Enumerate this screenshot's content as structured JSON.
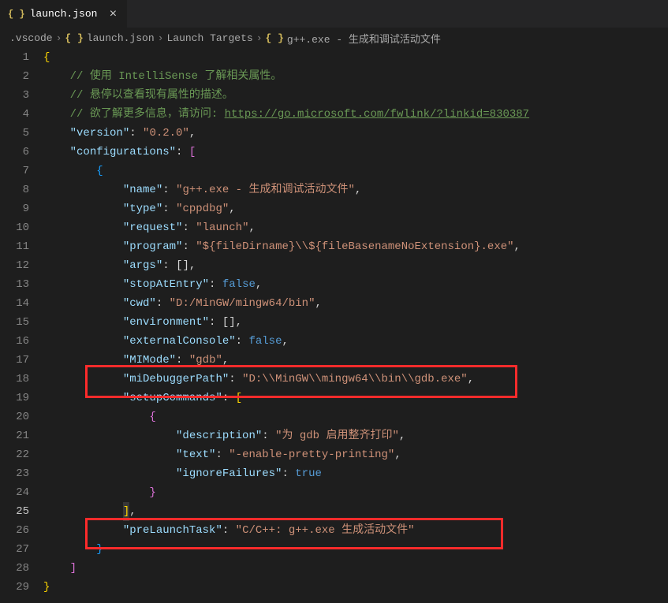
{
  "tab": {
    "icon": "{ }",
    "label": "launch.json",
    "close": "×"
  },
  "breadcrumb": {
    "c0": ".vscode",
    "c1_icon": "{ }",
    "c1": "launch.json",
    "c2": "Launch Targets",
    "c3_icon": "{ }",
    "c3": "g++.exe - 生成和调试活动文件",
    "chev": "›"
  },
  "gutter": {
    "l1": "1",
    "l2": "2",
    "l3": "3",
    "l4": "4",
    "l5": "5",
    "l6": "6",
    "l7": "7",
    "l8": "8",
    "l9": "9",
    "l10": "10",
    "l11": "11",
    "l12": "12",
    "l13": "13",
    "l14": "14",
    "l15": "15",
    "l16": "16",
    "l17": "17",
    "l18": "18",
    "l19": "19",
    "l20": "20",
    "l21": "21",
    "l22": "22",
    "l23": "23",
    "l24": "24",
    "l25": "25",
    "l26": "26",
    "l27": "27",
    "l28": "28",
    "l29": "29"
  },
  "c": {
    "openBrace": "{",
    "closeBrace": "}",
    "cmt1": "// 使用 IntelliSense 了解相关属性。",
    "cmt2": "// 悬停以查看现有属性的描述。",
    "cmt3a": "// 欲了解更多信息，请访问: ",
    "cmt3b": "https://go.microsoft.com/fwlink/?linkid=830387",
    "versionK": "\"version\"",
    "versionV": "\"0.2.0\"",
    "configsK": "\"configurations\"",
    "nameK": "\"name\"",
    "nameV": "\"g++.exe - 生成和调试活动文件\"",
    "typeK": "\"type\"",
    "typeV": "\"cppdbg\"",
    "requestK": "\"request\"",
    "requestV": "\"launch\"",
    "programK": "\"program\"",
    "programV": "\"${fileDirname}\\\\${fileBasenameNoExtension}.exe\"",
    "argsK": "\"args\"",
    "stopK": "\"stopAtEntry\"",
    "falseV": "false",
    "cwdK": "\"cwd\"",
    "cwdV": "\"D:/MinGW/mingw64/bin\"",
    "envK": "\"environment\"",
    "extK": "\"externalConsole\"",
    "miK": "\"MIMode\"",
    "miV": "\"gdb\"",
    "miPathK": "\"miDebuggerPath\"",
    "miPathV": "\"D:\\\\MinGW\\\\mingw64\\\\bin\\\\gdb.exe\"",
    "setupK": "\"setupCommands\"",
    "descK": "\"description\"",
    "descV": "\"为 gdb 启用整齐打印\"",
    "textK": "\"text\"",
    "textV": "\"-enable-pretty-printing\"",
    "ignK": "\"ignoreFailures\"",
    "trueV": "true",
    "preK": "\"preLaunchTask\"",
    "preV": "\"C/C++: g++.exe 生成活动文件\"",
    "colon": ": ",
    "comma": ",",
    "lbracket": "[",
    "rbracket": "]",
    "lbracketRbracket": "[]",
    "lbracketRbracketComma": "[],"
  }
}
